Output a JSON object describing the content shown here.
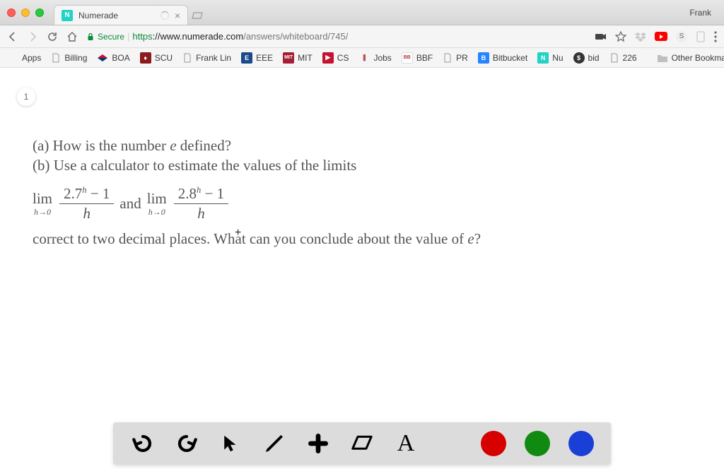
{
  "window": {
    "user": "Frank"
  },
  "tab": {
    "title": "Numerade",
    "favicon_letter": "N"
  },
  "address": {
    "secure_label": "Secure",
    "scheme": "https",
    "host": "://www.numerade.com",
    "path": "/answers/whiteboard/745/"
  },
  "bookmarks": {
    "apps": "Apps",
    "items": [
      {
        "label": "Billing"
      },
      {
        "label": "BOA"
      },
      {
        "label": "SCU"
      },
      {
        "label": "Frank Lin"
      },
      {
        "label": "EEE"
      },
      {
        "label": "MIT"
      },
      {
        "label": "CS"
      },
      {
        "label": "Jobs"
      },
      {
        "label": "BBF"
      },
      {
        "label": "PR"
      },
      {
        "label": "Bitbucket"
      },
      {
        "label": "Nu"
      },
      {
        "label": "bid"
      },
      {
        "label": "226"
      }
    ],
    "other": "Other Bookmarks"
  },
  "page": {
    "badge": "1",
    "line_a": "(a) How is the number ",
    "line_a_var": "e",
    "line_a_end": " defined?",
    "line_b": "(b) Use a calculator to estimate the values of the limits",
    "lim_label": "lim",
    "lim_below": "h→0",
    "frac1_num_base": "2.7",
    "frac1_num_rest": " − 1",
    "frac_den": "h",
    "and": " and ",
    "frac2_num_base": "2.8",
    "frac2_num_rest": " − 1",
    "line_c_1": "correct to two decimal places. What can you conclude about the value of ",
    "line_c_var": "e",
    "line_c_end": "?",
    "exp": "h"
  },
  "tools": {
    "colors": {
      "black": "#000000",
      "red": "#d60000",
      "green": "#118a11",
      "blue": "#1a3fd6"
    }
  }
}
